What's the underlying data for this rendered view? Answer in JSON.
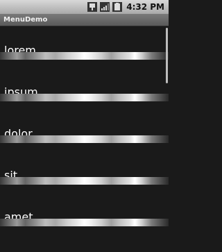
{
  "status_bar": {
    "time": "4:32 PM",
    "icons": [
      "usb-icon",
      "signal-icon",
      "battery-icon"
    ]
  },
  "app": {
    "title": "MenuDemo"
  },
  "list": {
    "items": [
      {
        "label": "lorem"
      },
      {
        "label": "ipsum"
      },
      {
        "label": "dolor"
      },
      {
        "label": "sit"
      },
      {
        "label": "amet"
      }
    ]
  },
  "colors": {
    "background": "#1a1a1a",
    "text": "#ffffff",
    "title_bar": "#6a6a6a"
  }
}
